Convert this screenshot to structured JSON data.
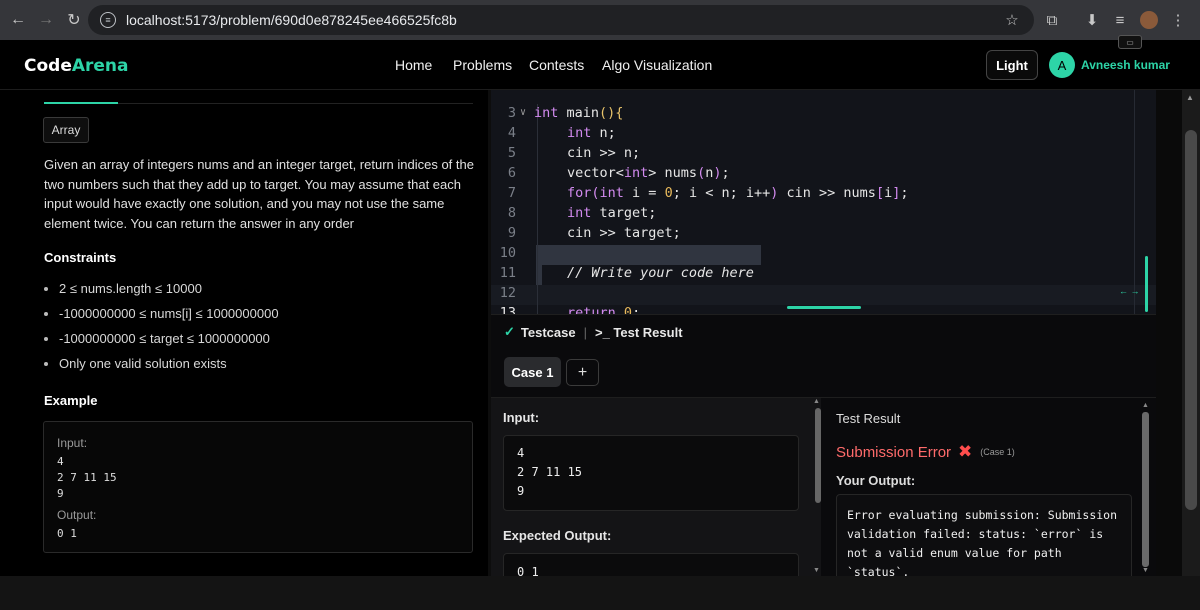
{
  "browser": {
    "url": "localhost:5173/problem/690d0e878245ee466525fc8b"
  },
  "header": {
    "logo_part1": "Code",
    "logo_part2": "Arena",
    "nav": [
      "Home",
      "Problems",
      "Contests",
      "Algo Visualization"
    ],
    "theme_button": "Light",
    "avatar_initial": "A",
    "username": "Avneesh kumar"
  },
  "problem": {
    "tag": "Array",
    "description": "Given an array of integers nums and an integer target, return indices of the two numbers such that they add up to target. You may assume that each input would have exactly one solution, and you may not use the same element twice. You can return the answer in any order",
    "constraints_heading": "Constraints",
    "constraints": [
      "2 ≤ nums.length ≤ 10000",
      "-1000000000 ≤ nums[i] ≤ 1000000000",
      "-1000000000 ≤ target ≤ 1000000000",
      "Only one valid solution exists"
    ],
    "example_heading": "Example",
    "example": {
      "input_label": "Input:",
      "input_lines": [
        "4",
        "2 7 11 15",
        "9"
      ],
      "output_label": "Output:",
      "output_line": "0 1"
    }
  },
  "editor": {
    "line_numbers": [
      "3",
      "4",
      "5",
      "6",
      "7",
      "8",
      "9",
      "10",
      "11",
      "12",
      "13"
    ],
    "active_line": "13"
  },
  "testpanel": {
    "tab_testcase": "Testcase",
    "tab_result": ">_ Test Result",
    "case_label": "Case 1",
    "add_label": "+",
    "input_label": "Input:",
    "input_lines": [
      "4",
      "2 7 11 15",
      "9"
    ],
    "expected_label": "Expected Output:",
    "expected_line": "0 1",
    "result_title": "Test Result",
    "status": "Submission Error",
    "status_case": "(Case 1)",
    "your_output_label": "Your Output:",
    "error_text": "Error evaluating submission: Submission validation failed: status: `error` is not a valid enum value for path `status`."
  },
  "colors": {
    "accent": "#2dd4a7",
    "error": "#ff6b6b"
  }
}
